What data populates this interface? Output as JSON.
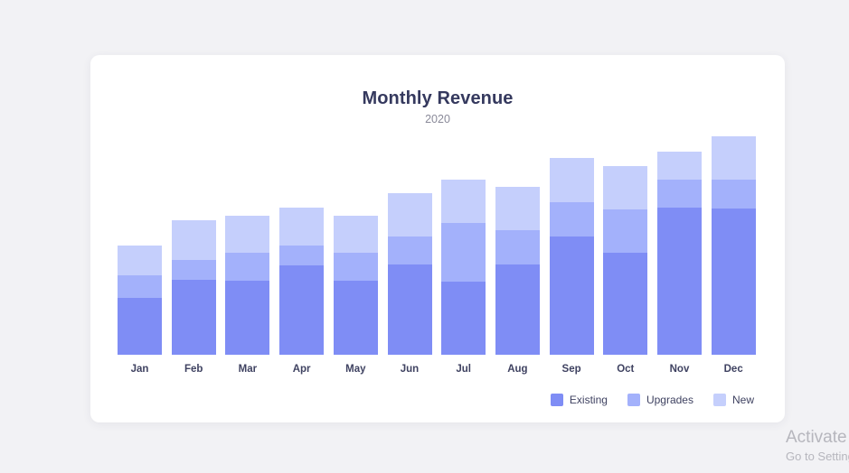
{
  "page": {
    "background_color": "#f2f2f5",
    "card_background": "#ffffff"
  },
  "card": {
    "title": "Monthly Revenue",
    "subtitle": "2020"
  },
  "legend": {
    "items": [
      {
        "label": "Existing",
        "color": "#7f8df5",
        "swatch": "legend-swatch-existing"
      },
      {
        "label": "Upgrades",
        "color": "#a3b1fb",
        "swatch": "legend-swatch-upgrades"
      },
      {
        "label": "New",
        "color": "#c5cffc",
        "swatch": "legend-swatch-new"
      }
    ]
  },
  "watermark": {
    "line1": "Activate Windows",
    "line2": "Go to Settings to activate"
  },
  "chart_data": {
    "type": "bar",
    "stacked": true,
    "title": "Monthly Revenue",
    "subtitle": "2020",
    "xlabel": "",
    "ylabel": "",
    "grid": false,
    "legend_position": "bottom-right",
    "axis_visible": false,
    "ylim": [
      0,
      250
    ],
    "categories": [
      "Jan",
      "Feb",
      "Mar",
      "Apr",
      "May",
      "Jun",
      "Jul",
      "Aug",
      "Sep",
      "Oct",
      "Nov",
      "Dec"
    ],
    "series": [
      {
        "name": "Existing",
        "color": "#7f8df5",
        "values": [
          63,
          83,
          82,
          99,
          82,
          100,
          81,
          100,
          131,
          113,
          163,
          162
        ]
      },
      {
        "name": "Upgrades",
        "color": "#a3b1fb",
        "values": [
          25,
          22,
          31,
          22,
          31,
          31,
          65,
          38,
          38,
          48,
          31,
          32
        ]
      },
      {
        "name": "New",
        "color": "#c5cffc",
        "values": [
          33,
          44,
          41,
          42,
          41,
          48,
          48,
          48,
          49,
          48,
          31,
          48
        ]
      }
    ],
    "totals": [
      121,
      149,
      154,
      163,
      154,
      179,
      194,
      186,
      218,
      209,
      225,
      242
    ]
  }
}
